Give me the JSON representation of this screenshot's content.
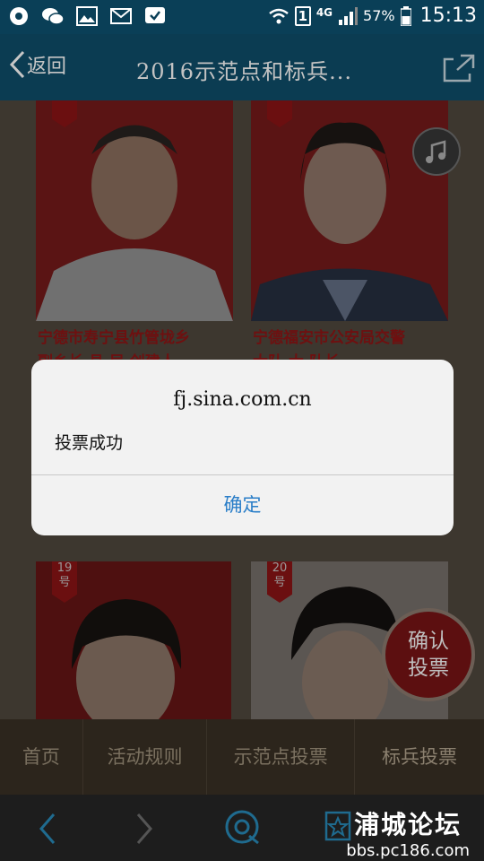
{
  "status_bar": {
    "network": "4G",
    "battery": "57%",
    "time": "15:13",
    "sim": "1"
  },
  "header": {
    "back_label": "返回",
    "title": "2016示范点和标兵..."
  },
  "candidates": [
    {
      "caption": "宁德市寿宁县竹管垅乡",
      "caption2": "副乡长 县 局 创建人",
      "badge": "号"
    },
    {
      "caption": "宁德福安市公安局交警",
      "caption2": "大队 大 队长",
      "badge": "号"
    },
    {
      "badge": "19\n号"
    },
    {
      "badge": "20\n号"
    }
  ],
  "vote_button": {
    "line1": "确认",
    "line2": "投票"
  },
  "bottom_nav": [
    "首页",
    "活动规则",
    "示范点投票",
    "标兵投票"
  ],
  "watermark": {
    "name": "浦城论坛",
    "url": "bbs.pc186.com"
  },
  "dialog": {
    "host": "fj.sina.com.cn",
    "message": "投票成功",
    "ok": "确定"
  }
}
